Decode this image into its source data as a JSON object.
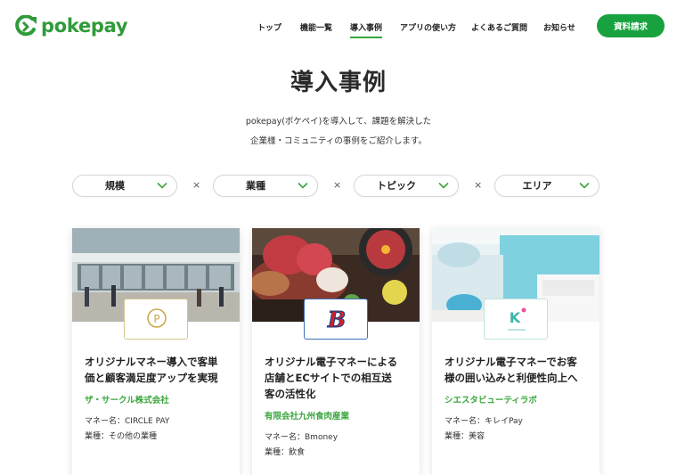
{
  "brand": {
    "name": "pokepay"
  },
  "nav": {
    "items": [
      {
        "label": "トップ"
      },
      {
        "label": "機能一覧"
      },
      {
        "label": "導入事例"
      },
      {
        "label": "アプリの使い方"
      },
      {
        "label": "よくあるご質問"
      },
      {
        "label": "お知らせ"
      }
    ],
    "active": "導入事例",
    "cta_label": "資料請求"
  },
  "page": {
    "title": "導入事例",
    "lead_line1": "pokepay(ポケペイ)を導入して、課題を解決した",
    "lead_line2": "企業様・コミュニティの事例をご紹介します。"
  },
  "filters": [
    {
      "label": "規模"
    },
    {
      "label": "業種"
    },
    {
      "label": "トピック"
    },
    {
      "label": "エリア"
    }
  ],
  "filter_separator": "×",
  "cards": [
    {
      "title_line1": "オリジナルマネー導入で客単",
      "title_line2": "価と顧客満足度アップを実現",
      "company": "ザ・サークル株式会社",
      "money": "マネー名：CIRCLE PAY",
      "industry": "業種：その他の業種",
      "logo_mark": "P"
    },
    {
      "title_line1": "オリジナル電子マネーによる",
      "title_line2": "店舗とECサイトでの相互送",
      "title_line3": "客の活性化",
      "company": "有限会社九州食肉産業",
      "money": "マネー名：Bmoney",
      "industry": "業種：飲食",
      "logo_mark": "B"
    },
    {
      "title_line1": "オリジナル電子マネーでお客",
      "title_line2": "様の囲い込みと利便性向上へ",
      "company": "シエスタビューティラボ",
      "money": "マネー名：キレイPay",
      "industry": "業種：美容",
      "logo_mark": "K"
    }
  ],
  "colors": {
    "brand_green": "#2f9b39",
    "cta_green": "#17a23f",
    "company_green": "#3aa63c"
  }
}
